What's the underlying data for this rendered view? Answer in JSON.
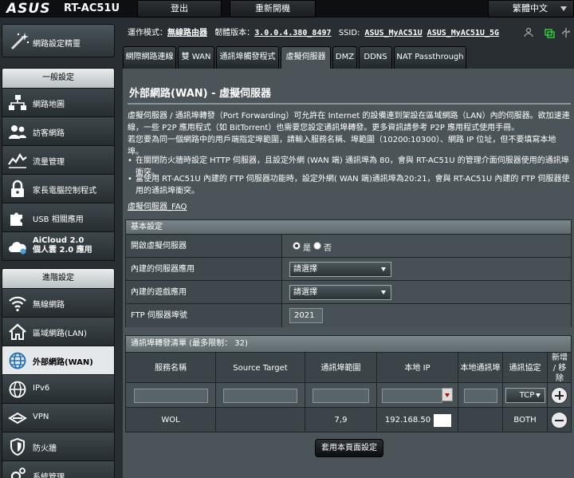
{
  "header": {
    "brand": "ASUS",
    "model": "RT-AC51U",
    "logout": "登出",
    "reboot": "重新開機",
    "language": "繁體中文"
  },
  "sidebar": {
    "qis": "網路設定精靈",
    "general_header": "一般設定",
    "general_items": [
      {
        "label": "網路地圖",
        "icon": "network-map-icon"
      },
      {
        "label": "訪客網路",
        "icon": "guest-network-icon"
      },
      {
        "label": "流量管理",
        "icon": "traffic-manager-icon"
      },
      {
        "label": "家長電腦控制程式",
        "icon": "parental-control-icon"
      },
      {
        "label": "USB 相關應用",
        "icon": "usb-icon"
      },
      {
        "label": "AiCloud 2.0",
        "label2": "個人雲 2.0 應用",
        "icon": "aicloud-icon"
      }
    ],
    "advanced_header": "進階設定",
    "advanced_items": [
      {
        "label": "無線網路",
        "icon": "wireless-icon"
      },
      {
        "label": "區域網路(LAN)",
        "icon": "lan-icon"
      },
      {
        "label": "外部網路(WAN)",
        "icon": "wan-icon",
        "active": true
      },
      {
        "label": "IPv6",
        "icon": "ipv6-icon"
      },
      {
        "label": "VPN",
        "icon": "vpn-icon"
      },
      {
        "label": "防火牆",
        "icon": "firewall-icon"
      },
      {
        "label": "系統管理",
        "icon": "administration-icon"
      }
    ]
  },
  "status": {
    "mode_label": "運作模式：",
    "mode_value": "無線路由器",
    "fw_label": "韌體版本：",
    "fw_value": "3.0.0.4.380_8497",
    "ssid_label": "SSID:",
    "ssid1": "ASUS_MyAC51U",
    "ssid2": "ASUS_MyAC51U_5G"
  },
  "tabs": [
    "網際網路連線",
    "雙 WAN",
    "通訊埠觸發程式",
    "虛擬伺服器",
    "DMZ",
    "DDNS",
    "NAT Passthrough"
  ],
  "page": {
    "title": "外部網路(WAN) - 虛擬伺服器",
    "desc1": "虛擬伺服器 / 通訊埠轉發（Port Forwarding）可允許在 Internet 的設備連到架設在區域網路（LAN）內的伺服器。欲加速連線，一些 P2P 應用程式（如 BitTorrent）也需要您設定通訊埠轉發。更多資訊請參考 P2P 應用程式使用手冊。",
    "desc2": "若您要為同一個網路中的用戶端指定埠範圍，請輸入服務名稱、埠範圍（10200:10300）、網路 IP 位址，但不要填寫本地埠。",
    "bullet1": "在關閉防火牆時設定 HTTP 伺服器，且設定外網 (WAN 端) 通訊埠為 80，會與 RT-AC51U 的管理介面伺服器使用的通訊埠衝突。",
    "bullet2": "當使用 RT-AC51U 內建的 FTP 伺服器功能時，設定外網( WAN 端)通訊埠為20:21，會與 RT-AC51U 內建的 FTP 伺服器使用的通訊埠衝突。",
    "faq": "虛擬伺服器_FAQ"
  },
  "basic": {
    "header": "基本設定",
    "enable_label": "開啟虛擬伺服器",
    "yes": "是",
    "no": "否",
    "famous_server_label": "內建的伺服器應用",
    "famous_server_value": "請選擇",
    "game_label": "內建的遊戲應用",
    "game_value": "請選擇",
    "ftp_label": "FTP 伺服器埠號",
    "ftp_value": "2021"
  },
  "list": {
    "header": "通訊埠轉發清單 (最多限制： 32)",
    "cols": [
      "服務名稱",
      "Source Target",
      "通訊埠範圍",
      "本地 IP",
      "本地通訊埠",
      "通訊協定",
      "新增 / 移除"
    ],
    "new_protocol": "TCP",
    "rows": [
      {
        "service": "WOL",
        "source": "",
        "port_range": "7,9",
        "local_ip": "192.168.50",
        "local_port": "",
        "protocol": "BOTH"
      }
    ]
  },
  "apply": "套用本頁面設定"
}
